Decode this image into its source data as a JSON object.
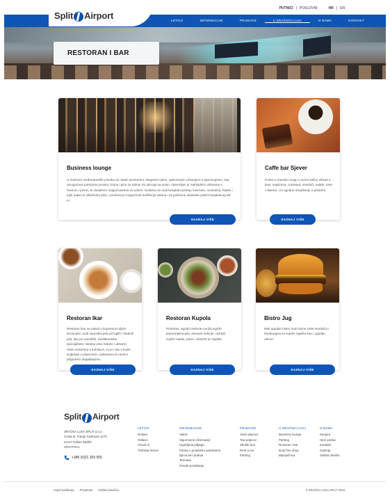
{
  "brand": {
    "name_left": "Split",
    "name_right": "Airport"
  },
  "utility": {
    "active": "PUTNICI",
    "sep": "|",
    "alt": "POSLOVNI",
    "lang_hr": "HR",
    "lang_sep": "|",
    "lang_en": "EN"
  },
  "nav": {
    "items": [
      {
        "label": "LETOVI"
      },
      {
        "label": "INFORMACIJE"
      },
      {
        "label": "PRIJEVOZ"
      },
      {
        "label": "U ZRAČNOJ LUCI"
      },
      {
        "label": "O NAMA"
      },
      {
        "label": "KONTAKT"
      }
    ],
    "active_index": 3
  },
  "hero": {
    "title": "RESTORAN I BAR"
  },
  "cards": [
    {
      "title": "Business lounge",
      "text": "U zračnom međunarodnih putnika se nalazi suvremeni, elegantni salon, oplemenjen uživanjem u spremnjenim, koji omogućava putnicima prostor, hranu i piće za odmor do ukrcaja na avion. Opremljen je rashladnim vitrinama s hranom i pićem, te dodatnim mogućnostima za odmor. Gostima se nudi besplatni pristup internetu, novinama, hladni i topli napici te alkoholna pića, i pružena je mogućnost korištenja salona i za poslovne sastanke putem besplatnog Wi-Fi.",
      "button": "SAZNAJ VIŠE"
    },
    {
      "title": "Caffe bar Sjever",
      "text": "Putnici u tranzitu mogu u ovom kafiću uživati u kavi, napitcima, croissant, sendviči, salate, torte i slastice. Uz ugodno osvježenje u prostoru.",
      "button": "SAZNAJ VIŠE"
    },
    {
      "title": "Restoran Ikar",
      "text": "Restoran Ikar se nalazi u kopnenom dijelu terminala i nudi raznolika jela od toplih i hladnih jela, jela po narudžbi, mediteranske specijalitete, lokalna vina, kolače i deserte. Osim restorana s kuhinjom, tu je i bar s kojim sudjeluje u prijemima i zabavama te raznim prigodnim događanjima.",
      "button": "SAZNAJ VIŠE"
    },
    {
      "title": "Restoran Kupola",
      "text": "Prostrani, ugodni restoran pruža svježe pripremljena jela, domaće kuhinje, ražnjići, svježe salate, pizze i deserte te napitke.",
      "button": "SAZNAJ VIŠE"
    },
    {
      "title": "Bistro Jug",
      "text": "Mali ugodan bistro nudi razne vrste sendviča i hamburgera te svježe napitke kao i ugodan odmor.",
      "button": "SAZNAJ VIŠE"
    }
  ],
  "footer": {
    "address": [
      "ZRAČNA LUKA SPLIT d.o.o.",
      "Cesta dr. Franje Tuđmana 1270",
      "21217 Kaštel Štafilić",
      "HRVATSKA"
    ],
    "phone": "+385 (0)21 203 555",
    "columns": [
      {
        "heading": "LETOVI",
        "links": [
          "Dolasci",
          "Odlasci",
          "Check in",
          "Traženje letova"
        ]
      },
      {
        "heading": "INFORMACIJE",
        "links": [
          "Vijesti",
          "Sigurnosne informacije",
          "Izgubljena prtljaga",
          "Putnici s posebnim potrebama",
          "Djeca bez pratnje",
          "Terminal",
          "Pravila ponašanja"
        ]
      },
      {
        "heading": "PRIJEVOZ",
        "links": [
          "Javni prijevoz",
          "Taxi prijevoz",
          "Shuttle bus",
          "Rent a car",
          "Parking"
        ]
      },
      {
        "heading": "U ZRAČNOJ LUCI",
        "links": [
          "Business lounge",
          "Parking",
          "Restoran i bar",
          "Duty free shop",
          "Mjenjačnica"
        ]
      },
      {
        "heading": "O NAMA",
        "links": [
          "Karijera",
          "Opći podaci",
          "Kontakti",
          "Galerija",
          "Zaštita okoliša"
        ]
      }
    ],
    "bottom_links": [
      "Uvjeti korištenja",
      "Privatnost",
      "Politika kolačića"
    ],
    "copyright": "© ZRAČNA LUKA SPLIT 2018"
  }
}
